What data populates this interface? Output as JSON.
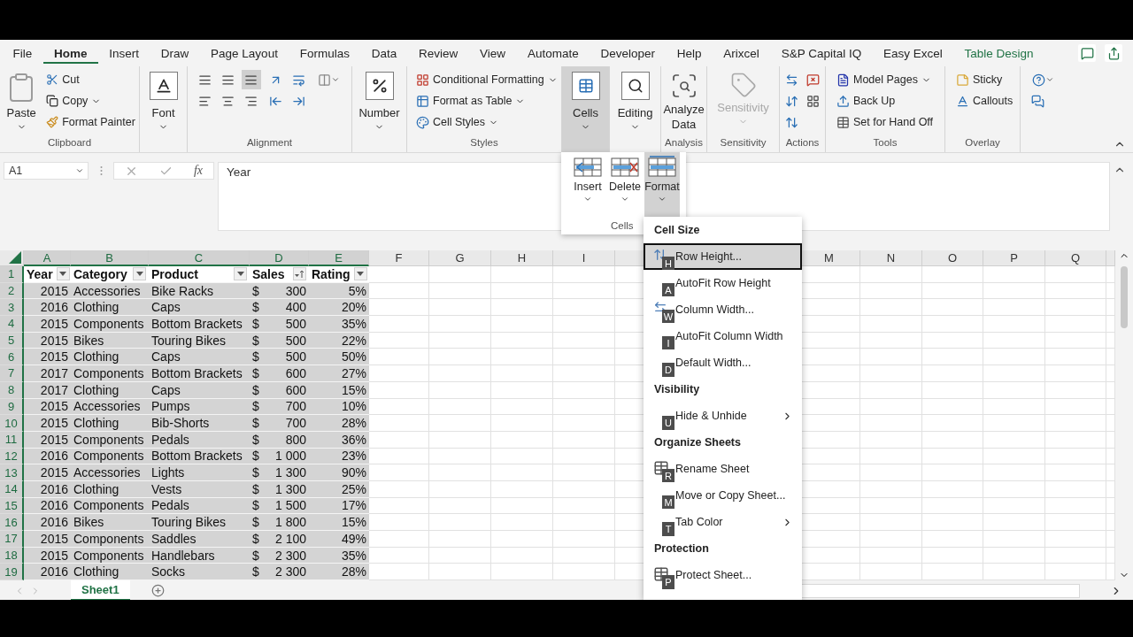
{
  "ribbon_tabs": [
    {
      "label": "File",
      "selected": false,
      "kind": "standard"
    },
    {
      "label": "Home",
      "selected": true,
      "kind": "standard"
    },
    {
      "label": "Insert",
      "selected": false,
      "kind": "standard"
    },
    {
      "label": "Draw",
      "selected": false,
      "kind": "standard"
    },
    {
      "label": "Page Layout",
      "selected": false,
      "kind": "standard"
    },
    {
      "label": "Formulas",
      "selected": false,
      "kind": "standard"
    },
    {
      "label": "Data",
      "selected": false,
      "kind": "standard"
    },
    {
      "label": "Review",
      "selected": false,
      "kind": "standard"
    },
    {
      "label": "View",
      "selected": false,
      "kind": "standard"
    },
    {
      "label": "Automate",
      "selected": false,
      "kind": "standard"
    },
    {
      "label": "Developer",
      "selected": false,
      "kind": "standard"
    },
    {
      "label": "Help",
      "selected": false,
      "kind": "standard"
    },
    {
      "label": "Arixcel",
      "selected": false,
      "kind": "standard"
    },
    {
      "label": "S&P Capital IQ",
      "selected": false,
      "kind": "standard"
    },
    {
      "label": "Easy Excel",
      "selected": false,
      "kind": "standard"
    },
    {
      "label": "Table Design",
      "selected": false,
      "kind": "contextual"
    }
  ],
  "ribbon": {
    "clipboard": {
      "label": "Clipboard",
      "paste": "Paste",
      "cut": "Cut",
      "copy": "Copy",
      "format_painter": "Format Painter"
    },
    "font": {
      "button": "Font"
    },
    "alignment": {
      "label": "Alignment",
      "vertical_align": [
        {
          "selected": false
        },
        {
          "selected": false
        },
        {
          "selected": true
        }
      ]
    },
    "number": {
      "button": "Number"
    },
    "styles": {
      "label": "Styles",
      "items": [
        {
          "label": "Conditional Formatting",
          "dropdown": true
        },
        {
          "label": "Format as Table",
          "dropdown": true
        },
        {
          "label": "Cell Styles",
          "dropdown": true
        }
      ]
    },
    "cells": {
      "button": "Cells",
      "expanded": true
    },
    "editing": {
      "button": "Editing"
    },
    "analysis": {
      "label": "Analysis",
      "button": "Analyze Data"
    },
    "sensitivity": {
      "label": "Sensitivity",
      "button": "Sensitivity",
      "disabled": true
    },
    "actions": {
      "label": "Actions"
    },
    "tools": {
      "label": "Tools",
      "items": [
        {
          "label": "Model Pages",
          "dropdown": true
        },
        {
          "label": "Back Up",
          "dropdown": false
        },
        {
          "label": "Set for Hand Off",
          "dropdown": false
        }
      ]
    },
    "overlay": {
      "label": "Overlay",
      "items": [
        "Sticky",
        "Callouts"
      ]
    }
  },
  "formula_bar": {
    "name_box": "A1",
    "function_label": "fx",
    "value": "Year"
  },
  "cells_dropdown": {
    "label": "Cells",
    "items": [
      {
        "label": "Insert",
        "selected": false
      },
      {
        "label": "Delete",
        "selected": false
      },
      {
        "label": "Format",
        "selected": true
      }
    ]
  },
  "format_menu": {
    "sections": [
      {
        "title": "Cell Size",
        "items": [
          {
            "label": "Row Height...",
            "key": "H",
            "kind": "row_height",
            "selected": true,
            "submenu": false
          },
          {
            "label": "AutoFit Row Height",
            "key": "A",
            "kind": "plain",
            "selected": false,
            "submenu": false
          },
          {
            "label": "Column Width...",
            "key": "W",
            "kind": "column_width",
            "selected": false,
            "submenu": false
          },
          {
            "label": "AutoFit Column Width",
            "key": "I",
            "kind": "plain",
            "selected": false,
            "submenu": false
          },
          {
            "label": "Default Width...",
            "key": "D",
            "kind": "plain",
            "selected": false,
            "submenu": false
          }
        ]
      },
      {
        "title": "Visibility",
        "items": [
          {
            "label": "Hide & Unhide",
            "key": "U",
            "kind": "plain",
            "selected": false,
            "submenu": true
          }
        ]
      },
      {
        "title": "Organize Sheets",
        "items": [
          {
            "label": "Rename Sheet",
            "key": "R",
            "kind": "sheet",
            "selected": false,
            "submenu": false
          },
          {
            "label": "Move or Copy Sheet...",
            "key": "M",
            "kind": "plain",
            "selected": false,
            "submenu": false
          },
          {
            "label": "Tab Color",
            "key": "T",
            "kind": "plain",
            "selected": false,
            "submenu": true
          }
        ]
      },
      {
        "title": "Protection",
        "items": [
          {
            "label": "Protect Sheet...",
            "key": "P",
            "kind": "sheet",
            "selected": false,
            "submenu": false
          }
        ]
      }
    ]
  },
  "sheet": {
    "columns_left": [
      {
        "label": "A",
        "selected": true
      },
      {
        "label": "B",
        "selected": true
      },
      {
        "label": "C",
        "selected": true
      },
      {
        "label": "D",
        "selected": true
      },
      {
        "label": "E",
        "selected": true
      },
      {
        "label": "F",
        "selected": false
      },
      {
        "label": "G",
        "selected": false
      },
      {
        "label": "H",
        "selected": false
      },
      {
        "label": "I",
        "selected": false
      }
    ],
    "columns_right": [
      {
        "label": "M",
        "selected": false
      },
      {
        "label": "N",
        "selected": false
      },
      {
        "label": "O",
        "selected": false
      },
      {
        "label": "P",
        "selected": false
      },
      {
        "label": "Q",
        "selected": false
      }
    ],
    "header": {
      "number": "1",
      "cells": [
        {
          "label": "Year",
          "sorted": false
        },
        {
          "label": "Category",
          "sorted": false
        },
        {
          "label": "Product",
          "sorted": false
        },
        {
          "label": "Sales",
          "sorted": true
        },
        {
          "label": "Rating",
          "sorted": false
        }
      ]
    },
    "rows": [
      {
        "number": "2",
        "selected": true,
        "year": "2015",
        "category": "Accessories",
        "product": "Bike Racks",
        "currency": "$",
        "sales": "300",
        "rating": "5%"
      },
      {
        "number": "3",
        "selected": true,
        "year": "2016",
        "category": "Clothing",
        "product": "Caps",
        "currency": "$",
        "sales": "400",
        "rating": "20%"
      },
      {
        "number": "4",
        "selected": true,
        "year": "2015",
        "category": "Components",
        "product": "Bottom Brackets",
        "currency": "$",
        "sales": "500",
        "rating": "35%"
      },
      {
        "number": "5",
        "selected": true,
        "year": "2015",
        "category": "Bikes",
        "product": "Touring Bikes",
        "currency": "$",
        "sales": "500",
        "rating": "22%"
      },
      {
        "number": "6",
        "selected": true,
        "year": "2015",
        "category": "Clothing",
        "product": "Caps",
        "currency": "$",
        "sales": "500",
        "rating": "50%"
      },
      {
        "number": "7",
        "selected": true,
        "year": "2017",
        "category": "Components",
        "product": "Bottom Brackets",
        "currency": "$",
        "sales": "600",
        "rating": "27%"
      },
      {
        "number": "8",
        "selected": true,
        "year": "2017",
        "category": "Clothing",
        "product": "Caps",
        "currency": "$",
        "sales": "600",
        "rating": "15%"
      },
      {
        "number": "9",
        "selected": true,
        "year": "2015",
        "category": "Accessories",
        "product": "Pumps",
        "currency": "$",
        "sales": "700",
        "rating": "10%"
      },
      {
        "number": "10",
        "selected": true,
        "year": "2015",
        "category": "Clothing",
        "product": "Bib-Shorts",
        "currency": "$",
        "sales": "700",
        "rating": "28%"
      },
      {
        "number": "11",
        "selected": true,
        "year": "2015",
        "category": "Components",
        "product": "Pedals",
        "currency": "$",
        "sales": "800",
        "rating": "36%"
      },
      {
        "number": "12",
        "selected": true,
        "year": "2016",
        "category": "Components",
        "product": "Bottom Brackets",
        "currency": "$",
        "sales": "1 000",
        "rating": "23%"
      },
      {
        "number": "13",
        "selected": true,
        "year": "2015",
        "category": "Accessories",
        "product": "Lights",
        "currency": "$",
        "sales": "1 300",
        "rating": "90%"
      },
      {
        "number": "14",
        "selected": true,
        "year": "2016",
        "category": "Clothing",
        "product": "Vests",
        "currency": "$",
        "sales": "1 300",
        "rating": "25%"
      },
      {
        "number": "15",
        "selected": true,
        "year": "2016",
        "category": "Components",
        "product": "Pedals",
        "currency": "$",
        "sales": "1 500",
        "rating": "17%"
      },
      {
        "number": "16",
        "selected": true,
        "year": "2016",
        "category": "Bikes",
        "product": "Touring Bikes",
        "currency": "$",
        "sales": "1 800",
        "rating": "15%"
      },
      {
        "number": "17",
        "selected": true,
        "year": "2015",
        "category": "Components",
        "product": "Saddles",
        "currency": "$",
        "sales": "2 100",
        "rating": "49%"
      },
      {
        "number": "18",
        "selected": true,
        "year": "2015",
        "category": "Components",
        "product": "Handlebars",
        "currency": "$",
        "sales": "2 300",
        "rating": "35%"
      },
      {
        "number": "19",
        "selected": true,
        "year": "2016",
        "category": "Clothing",
        "product": "Socks",
        "currency": "$",
        "sales": "2 300",
        "rating": "28%"
      }
    ]
  },
  "sheet_tabs": [
    {
      "label": "Sheet1",
      "selected": true
    }
  ]
}
